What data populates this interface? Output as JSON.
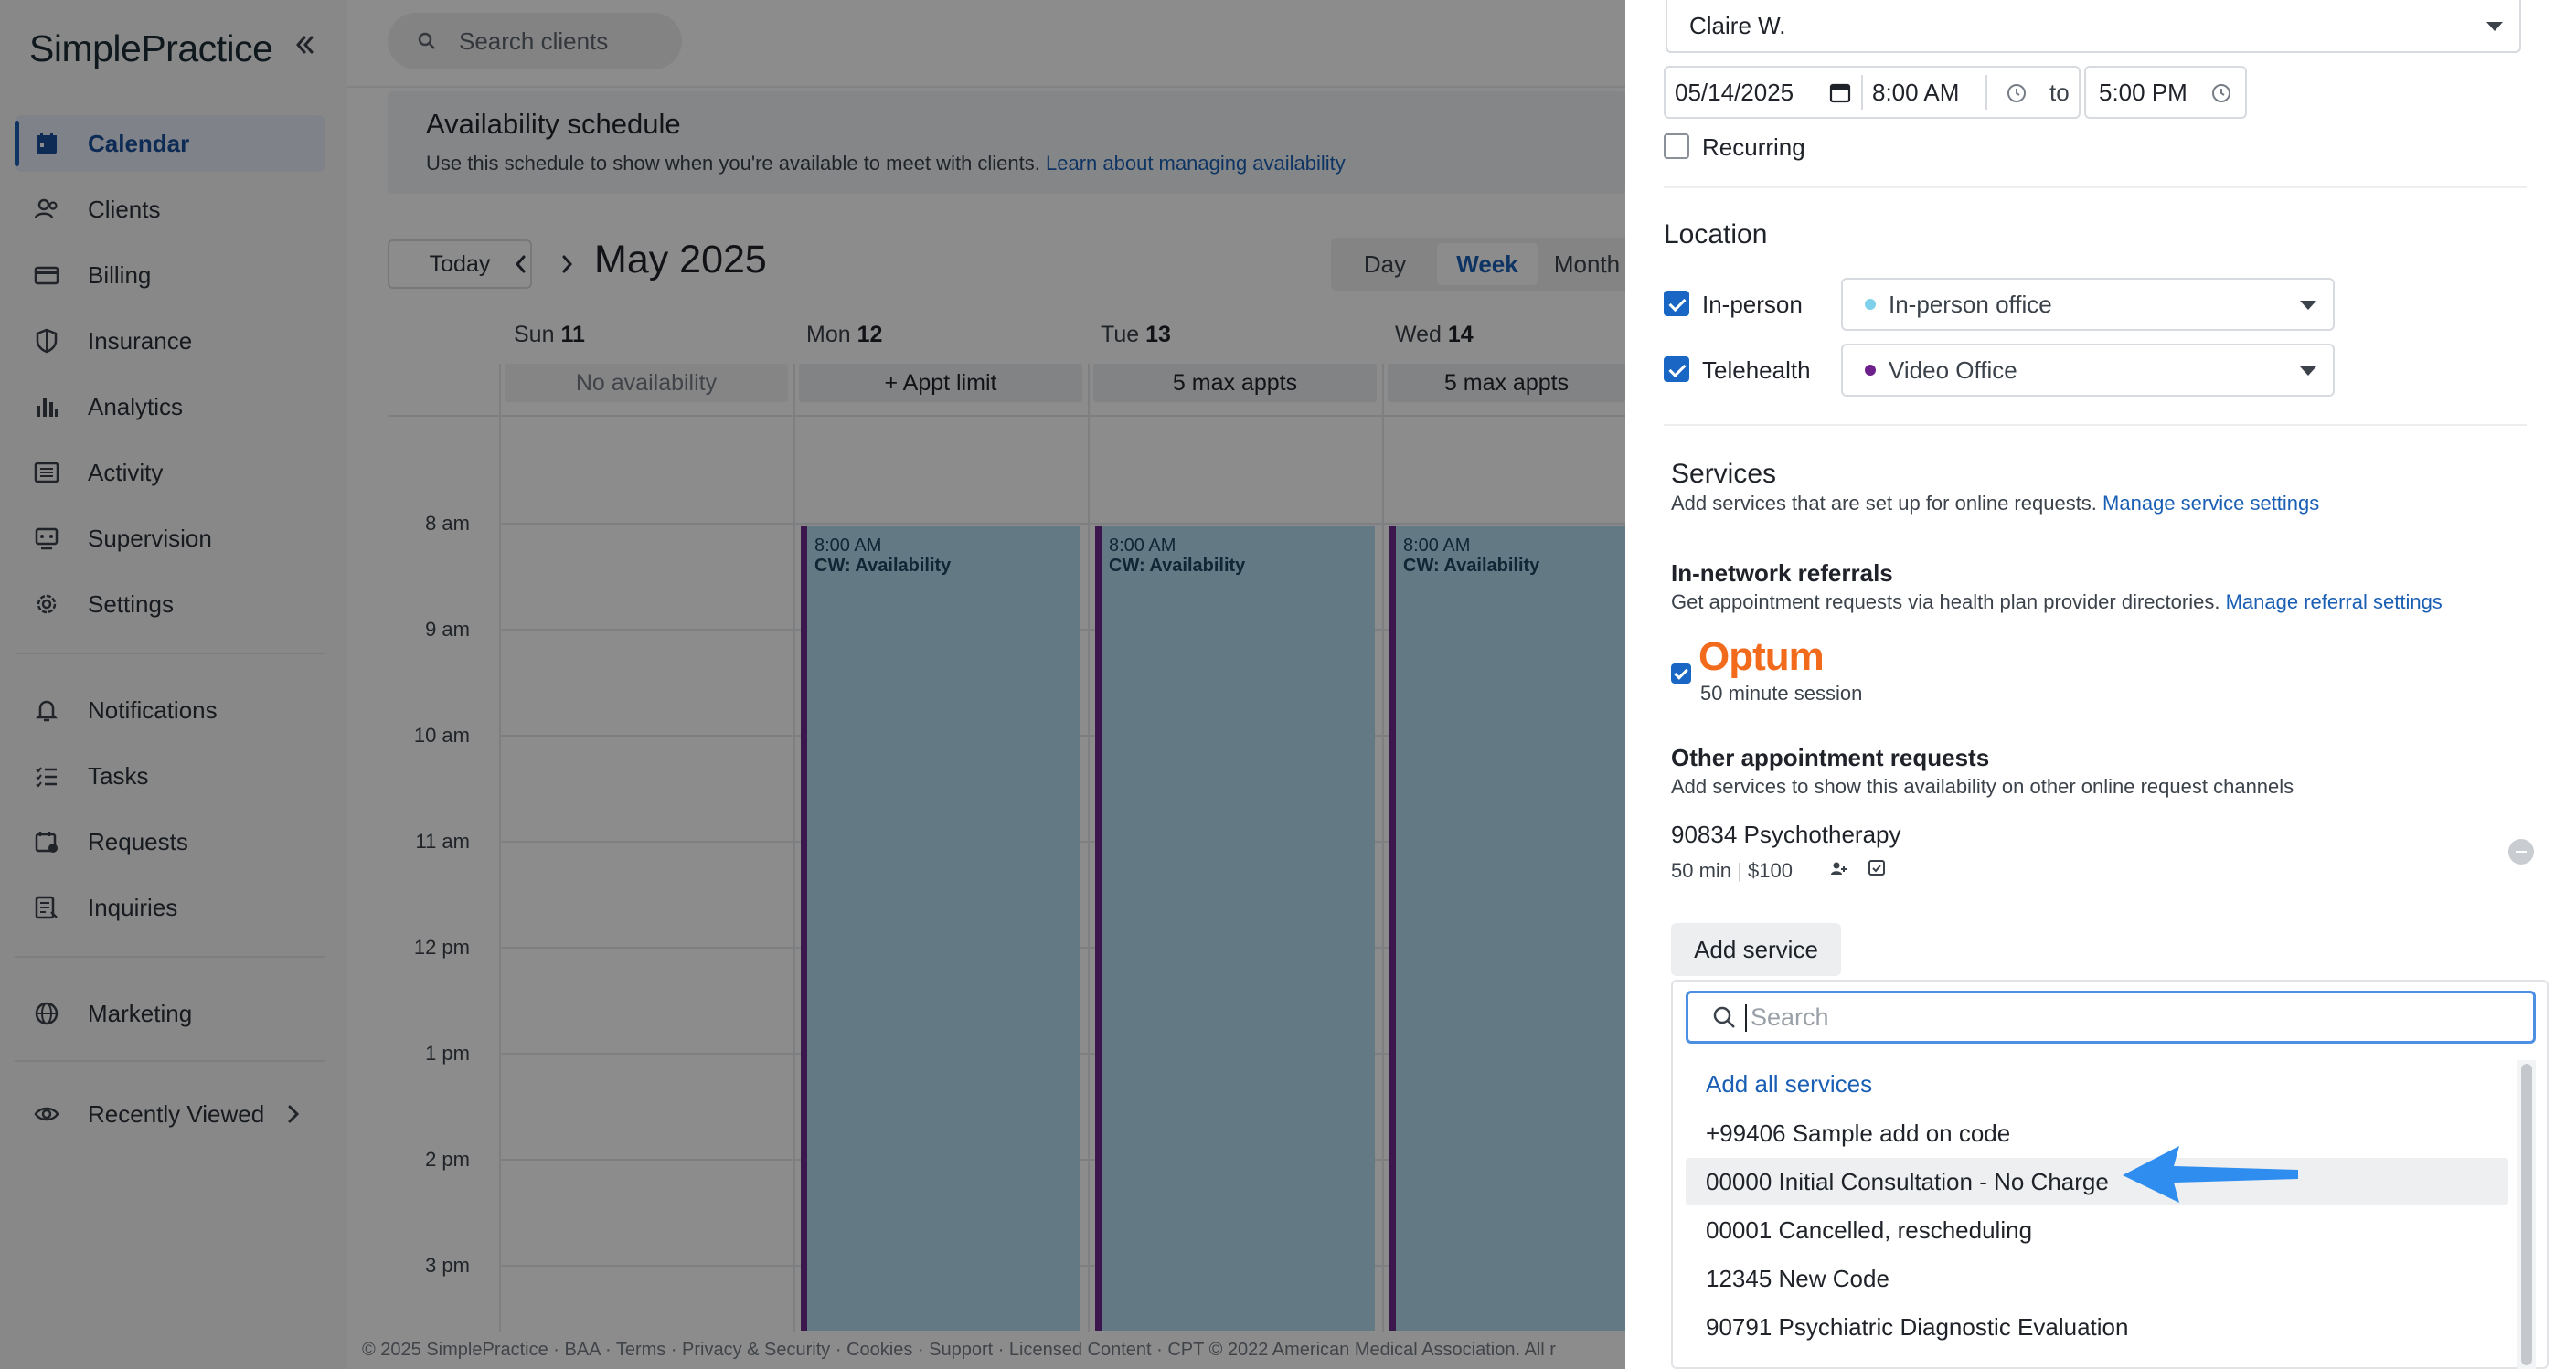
{
  "sidebar": {
    "logo": "SimplePractice",
    "items": [
      {
        "label": "Calendar",
        "icon": "calendar-icon",
        "active": true
      },
      {
        "label": "Clients",
        "icon": "clients-icon"
      },
      {
        "label": "Billing",
        "icon": "billing-icon"
      },
      {
        "label": "Insurance",
        "icon": "shield-icon"
      },
      {
        "label": "Analytics",
        "icon": "bar-chart-icon"
      },
      {
        "label": "Activity",
        "icon": "list-icon"
      },
      {
        "label": "Supervision",
        "icon": "supervision-icon"
      },
      {
        "label": "Settings",
        "icon": "gear-icon"
      },
      {
        "label": "Notifications",
        "icon": "bell-icon"
      },
      {
        "label": "Tasks",
        "icon": "tasks-icon"
      },
      {
        "label": "Requests",
        "icon": "requests-icon"
      },
      {
        "label": "Inquiries",
        "icon": "inquiries-icon"
      },
      {
        "label": "Marketing",
        "icon": "globe-icon"
      },
      {
        "label": "Recently Viewed",
        "icon": "eye-icon"
      }
    ]
  },
  "header": {
    "search_placeholder": "Search clients"
  },
  "banner": {
    "title": "Availability schedule",
    "description": "Use this schedule to show when you're available to meet with clients.",
    "link": "Learn about managing availability"
  },
  "calendar": {
    "today_label": "Today",
    "month_title": "May 2025",
    "views": [
      "Day",
      "Week",
      "Month"
    ],
    "selected_view": "Week",
    "days": [
      {
        "dow": "Sun",
        "num": "11",
        "badge": "No availability"
      },
      {
        "dow": "Mon",
        "num": "12",
        "badge": "+ Appt limit"
      },
      {
        "dow": "Tue",
        "num": "13",
        "badge": "5 max appts"
      },
      {
        "dow": "Wed",
        "num": "14",
        "badge": "5 max appts"
      }
    ],
    "hours": [
      "8 am",
      "9 am",
      "10 am",
      "11 am",
      "12 pm",
      "1 pm",
      "2 pm",
      "3 pm"
    ],
    "block_time": "8:00 AM",
    "block_label": "CW: Availability"
  },
  "footer": "© 2025 SimplePractice · BAA · Terms · Privacy & Security · Cookies · Support · Licensed Content · CPT © 2022 American Medical Association. All r",
  "panel": {
    "clinician": "Claire W.",
    "date": "05/14/2025",
    "start_time": "8:00 AM",
    "to_label": "to",
    "end_time": "5:00 PM",
    "recurring_label": "Recurring",
    "location_title": "Location",
    "locations": [
      {
        "label": "In-person",
        "value": "In-person office",
        "dot_color": "#7fd0ea"
      },
      {
        "label": "Telehealth",
        "value": "Video Office",
        "dot_color": "#6d1f8c"
      }
    ],
    "services_title": "Services",
    "services_desc": "Add services that are set up for online requests.",
    "services_link": "Manage service settings",
    "referrals_title": "In-network referrals",
    "referrals_desc": "Get appointment requests via health plan provider directories.",
    "referrals_link": "Manage referral settings",
    "optum_logo": "Optum",
    "optum_session": "50 minute session",
    "other_title": "Other appointment requests",
    "other_desc": "Add services to show this availability on other online request channels",
    "service_name": "90834 Psychotherapy",
    "service_duration": "50 min",
    "service_price": "$100",
    "add_service_label": "Add service",
    "dropdown": {
      "search_placeholder": "Search",
      "add_all": "Add all services",
      "options": [
        "+99406 Sample add on code",
        "00000 Initial Consultation - No Charge",
        "00001 Cancelled, rescheduling",
        "12345 New Code",
        "90791 Psychiatric Diagnostic Evaluation"
      ],
      "highlighted_index": 1
    }
  },
  "colors": {
    "accent": "#1a5fb4",
    "availability": "#b5dcee",
    "availability_border": "#6d2a8e",
    "optum": "#f26b1d",
    "annotation_arrow": "#2f8df0"
  }
}
